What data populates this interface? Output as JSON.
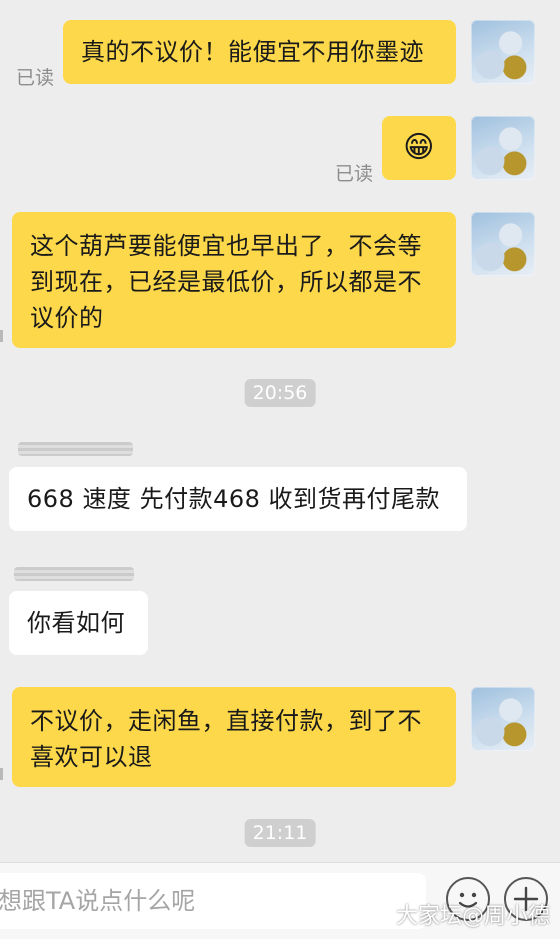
{
  "messages": {
    "m1": {
      "text": "真的不议价！能便宜不用你墨迹",
      "status": "已读"
    },
    "m2": {
      "emoji": "😁",
      "status": "已读"
    },
    "m3": {
      "text": "这个葫芦要能便宜也早出了，不会等到现在，已经是最低价，所以都是不议价的"
    },
    "time1": "20:56",
    "m4": {
      "text": "668 速度 先付款468 收到货再付尾款"
    },
    "m5": {
      "text": "你看如何"
    },
    "m6": {
      "text": "不议价，走闲鱼，直接付款，到了不喜欢可以退"
    },
    "time2": "21:11"
  },
  "input": {
    "placeholder": "想跟TA说点什么呢"
  },
  "icons": {
    "emoji_button": "smiley-icon",
    "plus_button": "plus-icon"
  },
  "colors": {
    "my_bubble": "#fcd84a",
    "other_bubble": "#ffffff",
    "background": "#ededed"
  },
  "watermark": "大家坛@周小德"
}
